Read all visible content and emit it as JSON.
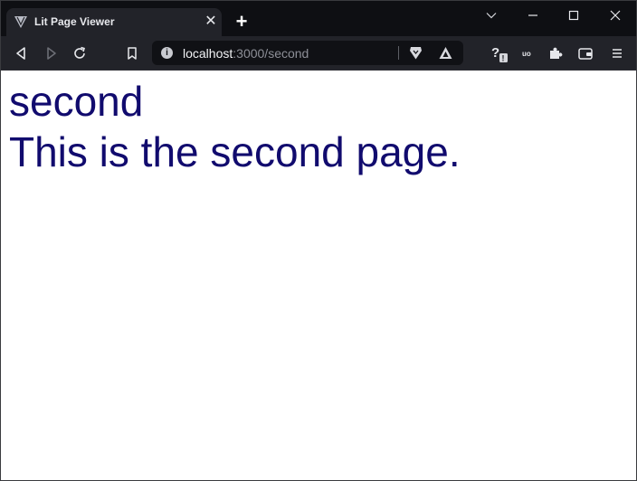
{
  "browser": {
    "tab": {
      "title": "Lit Page Viewer",
      "close_glyph": "✕"
    },
    "new_tab_glyph": "+",
    "address": {
      "host": "localhost",
      "path": ":3000/second"
    },
    "accent_color": "#110b6e"
  },
  "page": {
    "heading": "second",
    "body_text": "This is the second page."
  }
}
